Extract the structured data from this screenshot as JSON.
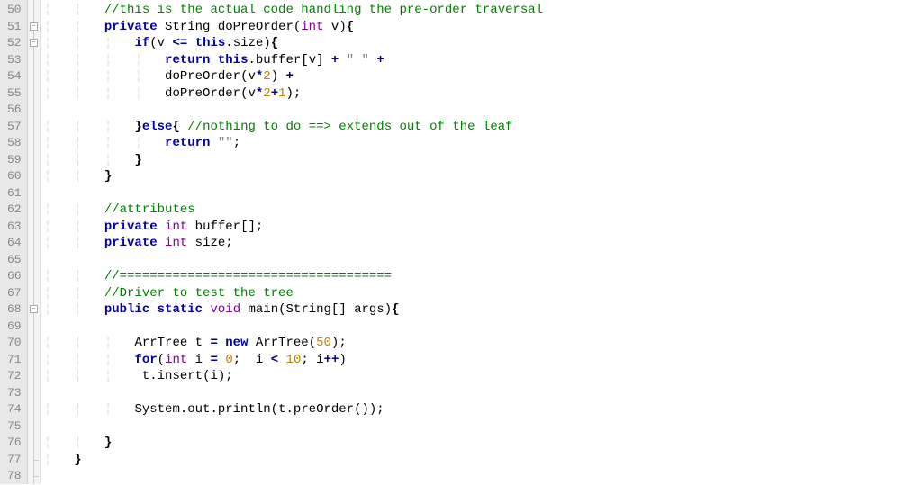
{
  "editor": {
    "first_line_no": 50,
    "lines": [
      {
        "indent": 2,
        "tokens": [
          {
            "c": "comment",
            "t": "//this is the actual code handling the pre-order traversal"
          }
        ]
      },
      {
        "indent": 2,
        "fold": "open",
        "tokens": [
          {
            "c": "kw",
            "t": "private"
          },
          {
            "c": "ident",
            "t": " String doPreOrder"
          },
          {
            "c": "punc",
            "t": "("
          },
          {
            "c": "type",
            "t": "int"
          },
          {
            "c": "ident",
            "t": " v"
          },
          {
            "c": "punc",
            "t": ")"
          },
          {
            "c": "brace",
            "t": "{"
          }
        ]
      },
      {
        "indent": 3,
        "fold": "open",
        "tokens": [
          {
            "c": "kw",
            "t": "if"
          },
          {
            "c": "punc",
            "t": "(v "
          },
          {
            "c": "op",
            "t": "<="
          },
          {
            "c": "punc",
            "t": " "
          },
          {
            "c": "kw",
            "t": "this"
          },
          {
            "c": "punc",
            "t": ".size)"
          },
          {
            "c": "brace",
            "t": "{"
          }
        ]
      },
      {
        "indent": 4,
        "tokens": [
          {
            "c": "kw",
            "t": "return"
          },
          {
            "c": "punc",
            "t": " "
          },
          {
            "c": "kw",
            "t": "this"
          },
          {
            "c": "punc",
            "t": ".buffer[v] "
          },
          {
            "c": "op",
            "t": "+"
          },
          {
            "c": "punc",
            "t": " "
          },
          {
            "c": "str",
            "t": "\" \""
          },
          {
            "c": "punc",
            "t": " "
          },
          {
            "c": "op",
            "t": "+"
          }
        ]
      },
      {
        "indent": 4,
        "tokens": [
          {
            "c": "ident",
            "t": "doPreOrder"
          },
          {
            "c": "punc",
            "t": "(v"
          },
          {
            "c": "op",
            "t": "*"
          },
          {
            "c": "num",
            "t": "2"
          },
          {
            "c": "punc",
            "t": ") "
          },
          {
            "c": "op",
            "t": "+"
          }
        ]
      },
      {
        "indent": 4,
        "tokens": [
          {
            "c": "ident",
            "t": "doPreOrder"
          },
          {
            "c": "punc",
            "t": "(v"
          },
          {
            "c": "op",
            "t": "*"
          },
          {
            "c": "num",
            "t": "2"
          },
          {
            "c": "op",
            "t": "+"
          },
          {
            "c": "num",
            "t": "1"
          },
          {
            "c": "punc",
            "t": ");"
          }
        ]
      },
      {
        "indent": 0,
        "tokens": []
      },
      {
        "indent": 3,
        "tokens": [
          {
            "c": "brace",
            "t": "}"
          },
          {
            "c": "kw",
            "t": "else"
          },
          {
            "c": "brace",
            "t": "{"
          },
          {
            "c": "punc",
            "t": " "
          },
          {
            "c": "comment",
            "t": "//nothing to do ==> extends out of the leaf"
          }
        ]
      },
      {
        "indent": 4,
        "tokens": [
          {
            "c": "kw",
            "t": "return"
          },
          {
            "c": "punc",
            "t": " "
          },
          {
            "c": "str",
            "t": "\"\""
          },
          {
            "c": "punc",
            "t": ";"
          }
        ]
      },
      {
        "indent": 3,
        "tokens": [
          {
            "c": "brace",
            "t": "}"
          }
        ]
      },
      {
        "indent": 2,
        "tokens": [
          {
            "c": "brace",
            "t": "}"
          }
        ]
      },
      {
        "indent": 0,
        "tokens": []
      },
      {
        "indent": 2,
        "tokens": [
          {
            "c": "comment",
            "t": "//attributes"
          }
        ]
      },
      {
        "indent": 2,
        "tokens": [
          {
            "c": "kw",
            "t": "private"
          },
          {
            "c": "punc",
            "t": " "
          },
          {
            "c": "type",
            "t": "int"
          },
          {
            "c": "ident",
            "t": " buffer"
          },
          {
            "c": "punc",
            "t": "[];"
          }
        ]
      },
      {
        "indent": 2,
        "tokens": [
          {
            "c": "kw",
            "t": "private"
          },
          {
            "c": "punc",
            "t": " "
          },
          {
            "c": "type",
            "t": "int"
          },
          {
            "c": "ident",
            "t": " size"
          },
          {
            "c": "punc",
            "t": ";"
          }
        ]
      },
      {
        "indent": 0,
        "tokens": []
      },
      {
        "indent": 2,
        "tokens": [
          {
            "c": "comment",
            "t": "//===================================="
          }
        ]
      },
      {
        "indent": 2,
        "tokens": [
          {
            "c": "comment",
            "t": "//Driver to test the tree"
          }
        ]
      },
      {
        "indent": 2,
        "fold": "open",
        "tokens": [
          {
            "c": "kw",
            "t": "public"
          },
          {
            "c": "punc",
            "t": " "
          },
          {
            "c": "kw",
            "t": "static"
          },
          {
            "c": "punc",
            "t": " "
          },
          {
            "c": "type",
            "t": "void"
          },
          {
            "c": "ident",
            "t": " main"
          },
          {
            "c": "punc",
            "t": "(String[] args)"
          },
          {
            "c": "brace",
            "t": "{"
          }
        ]
      },
      {
        "indent": 0,
        "tokens": []
      },
      {
        "indent": 3,
        "tokens": [
          {
            "c": "ident",
            "t": "ArrTree t "
          },
          {
            "c": "op",
            "t": "="
          },
          {
            "c": "punc",
            "t": " "
          },
          {
            "c": "kw",
            "t": "new"
          },
          {
            "c": "ident",
            "t": " ArrTree"
          },
          {
            "c": "punc",
            "t": "("
          },
          {
            "c": "num",
            "t": "50"
          },
          {
            "c": "punc",
            "t": ");"
          }
        ]
      },
      {
        "indent": 3,
        "tokens": [
          {
            "c": "kw",
            "t": "for"
          },
          {
            "c": "punc",
            "t": "("
          },
          {
            "c": "type",
            "t": "int"
          },
          {
            "c": "ident",
            "t": " i "
          },
          {
            "c": "op",
            "t": "="
          },
          {
            "c": "punc",
            "t": " "
          },
          {
            "c": "num",
            "t": "0"
          },
          {
            "c": "punc",
            "t": ";  i "
          },
          {
            "c": "op",
            "t": "<"
          },
          {
            "c": "punc",
            "t": " "
          },
          {
            "c": "num",
            "t": "10"
          },
          {
            "c": "punc",
            "t": "; i"
          },
          {
            "c": "op",
            "t": "++"
          },
          {
            "c": "punc",
            "t": ")"
          }
        ]
      },
      {
        "indent": 3,
        "tokens": [
          {
            "c": "ident",
            "t": " t.insert"
          },
          {
            "c": "punc",
            "t": "(i);"
          }
        ]
      },
      {
        "indent": 0,
        "tokens": []
      },
      {
        "indent": 3,
        "tokens": [
          {
            "c": "ident",
            "t": "System.out.println"
          },
          {
            "c": "punc",
            "t": "(t.preOrder());"
          }
        ]
      },
      {
        "indent": 0,
        "tokens": []
      },
      {
        "indent": 2,
        "tokens": [
          {
            "c": "brace",
            "t": "}"
          }
        ]
      },
      {
        "indent": 1,
        "fold": "end",
        "tokens": [
          {
            "c": "brace",
            "t": "}"
          }
        ]
      },
      {
        "indent": 0,
        "fold": "end",
        "tokens": []
      }
    ]
  }
}
